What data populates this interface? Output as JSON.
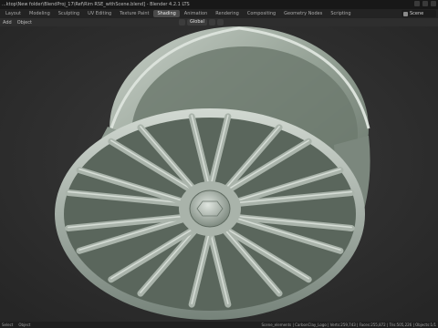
{
  "window": {
    "title": "...ktop\\New folder\\BlendProj_17\\Ref\\Rim RSE_withScene.blend] - Blender 4.2.1 LTS"
  },
  "workspace_tabs": [
    {
      "label": "Layout",
      "active": false
    },
    {
      "label": "Modeling",
      "active": false
    },
    {
      "label": "Sculpting",
      "active": false
    },
    {
      "label": "UV Editing",
      "active": false
    },
    {
      "label": "Texture Paint",
      "active": false
    },
    {
      "label": "Shading",
      "active": true
    },
    {
      "label": "Animation",
      "active": false
    },
    {
      "label": "Rendering",
      "active": false
    },
    {
      "label": "Compositing",
      "active": false
    },
    {
      "label": "Geometry Nodes",
      "active": false
    },
    {
      "label": "Scripting",
      "active": false
    }
  ],
  "scene_selector": {
    "label": "Scene"
  },
  "viewport_header": {
    "menus": [
      "Add",
      "Object"
    ],
    "transform_orientation": "Global"
  },
  "status_bar": {
    "left": [
      "Select",
      "Object"
    ],
    "right": "Scene_elements | CarbonClay_Logo | Verts:259,743 | Faces:255,872 | Tris:505,226 | Objects:1/1"
  },
  "colors": {
    "rim_base": "#9aa59b",
    "rim_highlight": "#cfd6cf",
    "rim_shadow": "#5e6a60",
    "viewport_bg": "#2f2f2f",
    "active_tab": "#4a4a4a"
  }
}
